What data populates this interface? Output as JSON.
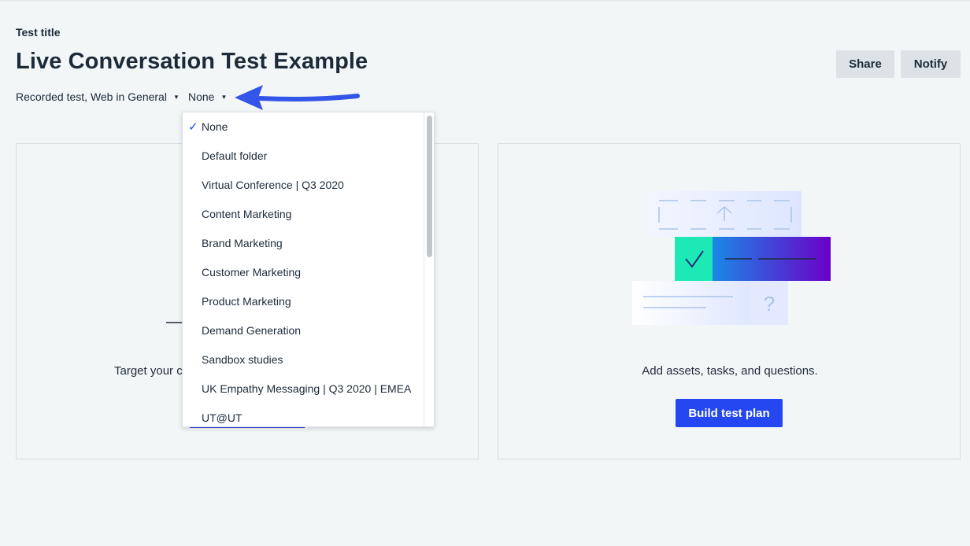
{
  "header": {
    "label": "Test title",
    "title": "Live Conversation Test Example",
    "share_label": "Share",
    "notify_label": "Notify"
  },
  "meta": {
    "test_type": "Recorded test, Web in General",
    "folder": "None"
  },
  "left_card": {
    "text": "Target your c"
  },
  "right_card": {
    "text": "Add assets, tasks, and questions.",
    "button_label": "Build test plan"
  },
  "dropdown": {
    "selected": "None",
    "items": [
      "None",
      "Default folder",
      "Virtual Conference | Q3 2020",
      "Content Marketing",
      "Brand Marketing",
      "Customer Marketing",
      "Product Marketing",
      "Demand Generation",
      "Sandbox studies",
      "UK Empathy Messaging | Q3 2020 | EMEA",
      "UT@UT"
    ]
  },
  "colors": {
    "accent": "#2447f2",
    "annotation_arrow": "#3355e8"
  }
}
